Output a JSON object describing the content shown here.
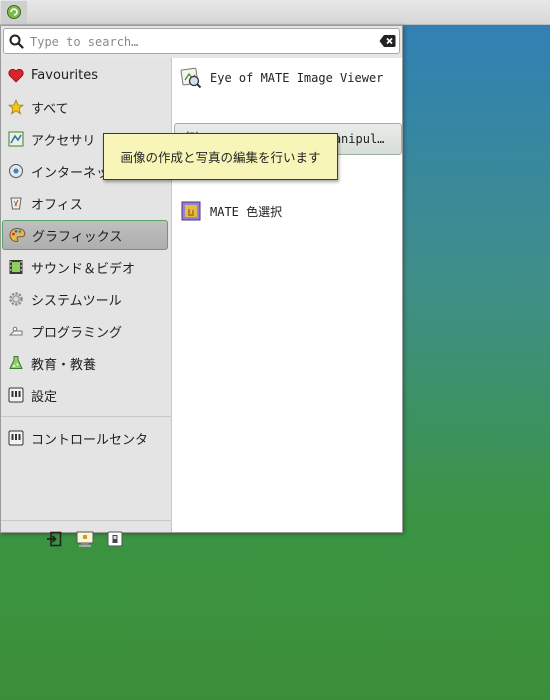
{
  "search": {
    "placeholder": "Type to search…"
  },
  "categories": [
    {
      "label": "Favourites",
      "icon": "heart-icon"
    },
    {
      "label": "すべて",
      "icon": "star-icon"
    },
    {
      "label": "アクセサリ",
      "icon": "accessories-icon"
    },
    {
      "label": "インターネット",
      "icon": "globe-icon"
    },
    {
      "label": "オフィス",
      "icon": "office-icon"
    },
    {
      "label": "グラフィックス",
      "icon": "palette-icon"
    },
    {
      "label": "サウンド＆ビデオ",
      "icon": "film-icon"
    },
    {
      "label": "システムツール",
      "icon": "gear-icon"
    },
    {
      "label": "プログラミング",
      "icon": "programming-icon"
    },
    {
      "label": "教育・教養",
      "icon": "education-icon"
    },
    {
      "label": "設定",
      "icon": "settings-icon"
    },
    {
      "label": "コントロールセンタ",
      "icon": "control-center-icon"
    }
  ],
  "apps": [
    {
      "label": "Eye of MATE Image Viewer",
      "icon": "image-viewer-icon"
    },
    {
      "label": "GIMP (GNU Image Manipul…",
      "icon": "gimp-icon"
    },
    {
      "label": "MATE 色選択",
      "icon": "color-picker-icon"
    }
  ],
  "tooltip": {
    "text": "画像の作成と写真の編集を行います"
  },
  "colors": {
    "selection_border": "#5aa56a",
    "tooltip_bg": "#f7f6b8",
    "desktop_top": "#2f7fb8",
    "desktop_bottom": "#3c8f3a"
  }
}
